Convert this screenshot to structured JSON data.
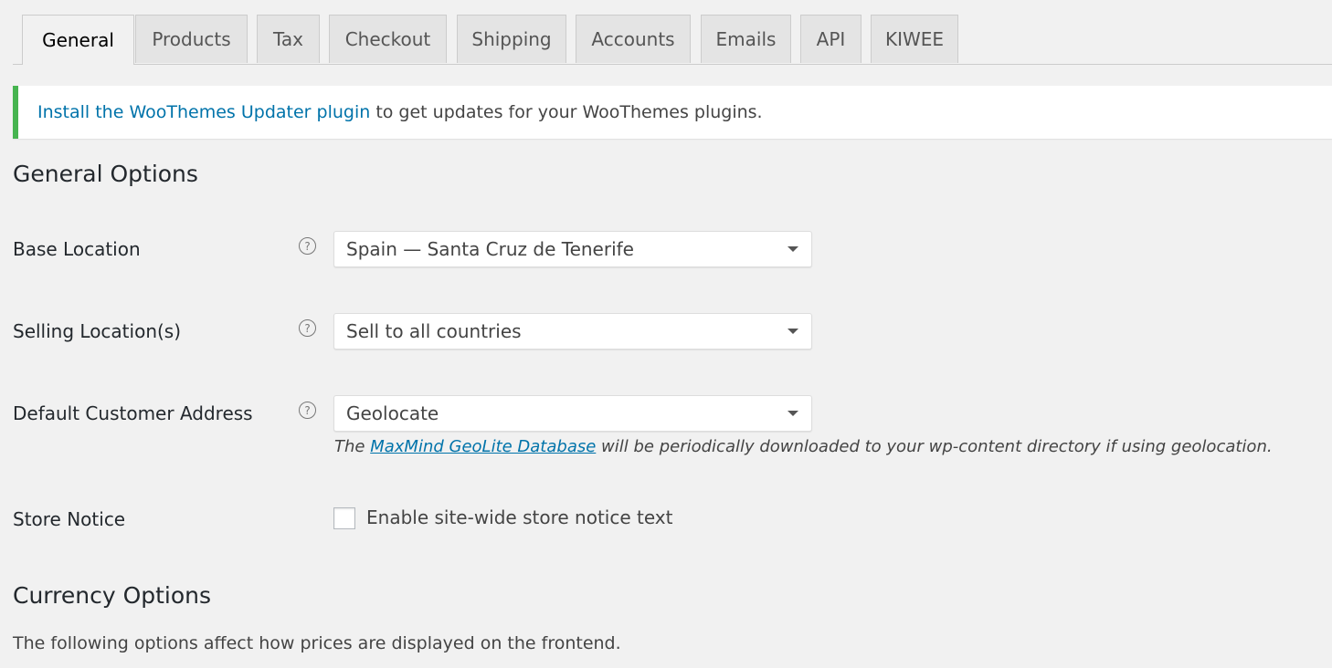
{
  "tabs": [
    {
      "label": "General",
      "active": true
    },
    {
      "label": "Products",
      "active": false
    },
    {
      "label": "Tax",
      "active": false
    },
    {
      "label": "Checkout",
      "active": false
    },
    {
      "label": "Shipping",
      "active": false
    },
    {
      "label": "Accounts",
      "active": false
    },
    {
      "label": "Emails",
      "active": false
    },
    {
      "label": "API",
      "active": false
    },
    {
      "label": "KIWEE",
      "active": false
    }
  ],
  "notice": {
    "link_text": "Install the WooThemes Updater plugin",
    "text": " to get updates for your WooThemes plugins.",
    "accent_color": "#46b450"
  },
  "general_options": {
    "heading": "General Options",
    "fields": [
      {
        "label": "Base Location",
        "help_icon": "?",
        "value": "Spain — Santa Cruz de Tenerife"
      },
      {
        "label": "Selling Location(s)",
        "help_icon": "?",
        "value": "Sell to all countries"
      },
      {
        "label": "Default Customer Address",
        "help_icon": "?",
        "value": "Geolocate"
      }
    ],
    "geolocate_desc": {
      "prefix": "The ",
      "link_text": "MaxMind GeoLite Database",
      "suffix": " will be periodically downloaded to your wp-content directory if using geolocation."
    },
    "store_notice": {
      "label": "Store Notice",
      "checkbox_label": "Enable site-wide store notice text",
      "checked": false
    }
  },
  "currency_options": {
    "heading": "Currency Options",
    "description": "The following options affect how prices are displayed on the frontend."
  }
}
